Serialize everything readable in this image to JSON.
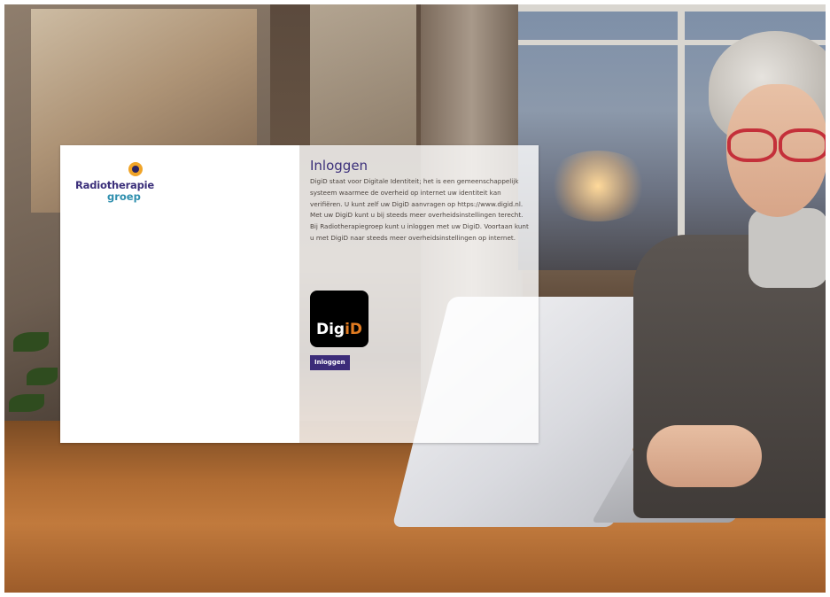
{
  "logo": {
    "line1": "Radiotherapie",
    "line2": "groep",
    "icon": "radiotherapie-logo-mark"
  },
  "login": {
    "title": "Inloggen",
    "description": "DigiD staat voor Digitale Identiteit; het is een gemeenschappelijk systeem waarmee de overheid op internet uw identiteit kan verifiëren. U kunt zelf uw DigiD aanvragen op https://www.digid.nl. Met uw DigiD kunt u bij steeds meer overheidsinstellingen terecht. Bij Radiotherapiegroep kunt u inloggen met uw DigiD. Voortaan kunt u met DigiD naar steeds meer overheidsinstellingen op internet.",
    "digid_logo": {
      "part1": "Dig",
      "part2": "iD"
    },
    "button_label": "Inloggen"
  },
  "colors": {
    "brand_purple": "#3b2f7a",
    "brand_teal": "#2f8fae",
    "digid_orange": "#e17b21",
    "button_bg": "#3c2c79"
  }
}
